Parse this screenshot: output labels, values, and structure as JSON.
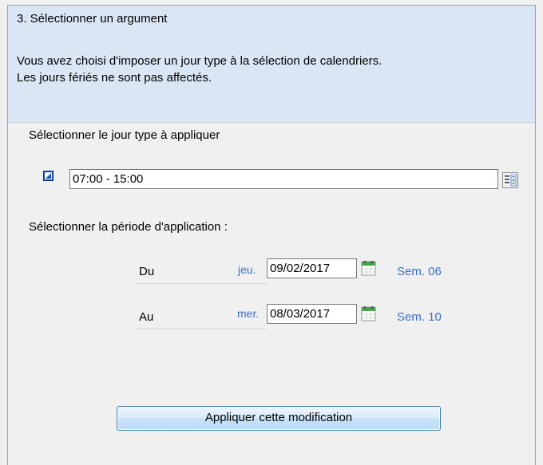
{
  "header": {
    "step_title": "3. Sélectionner un argument",
    "description_line1": "Vous avez choisi d'imposer un jour type à la sélection de calendriers.",
    "description_line2": "Les jours fériés ne sont pas affectés."
  },
  "day_type": {
    "label": "Sélectionner le jour type à appliquer",
    "value": "07:00 - 15:00",
    "icon": "day-type-icon",
    "picker_icon": "list-picker-icon"
  },
  "period": {
    "label": "Sélectionner la période d'application :",
    "from": {
      "label": "Du",
      "weekday": "jeu.",
      "date": "09/02/2017",
      "week": "Sem. 06"
    },
    "to": {
      "label": "Au",
      "weekday": "mer.",
      "date": "08/03/2017",
      "week": "Sem. 10"
    }
  },
  "apply_button": {
    "label": "Appliquer cette modification"
  },
  "colors": {
    "header_bg": "#dbe6f4",
    "accent_text": "#3c6fcf",
    "button_border": "#3c7fb1"
  }
}
